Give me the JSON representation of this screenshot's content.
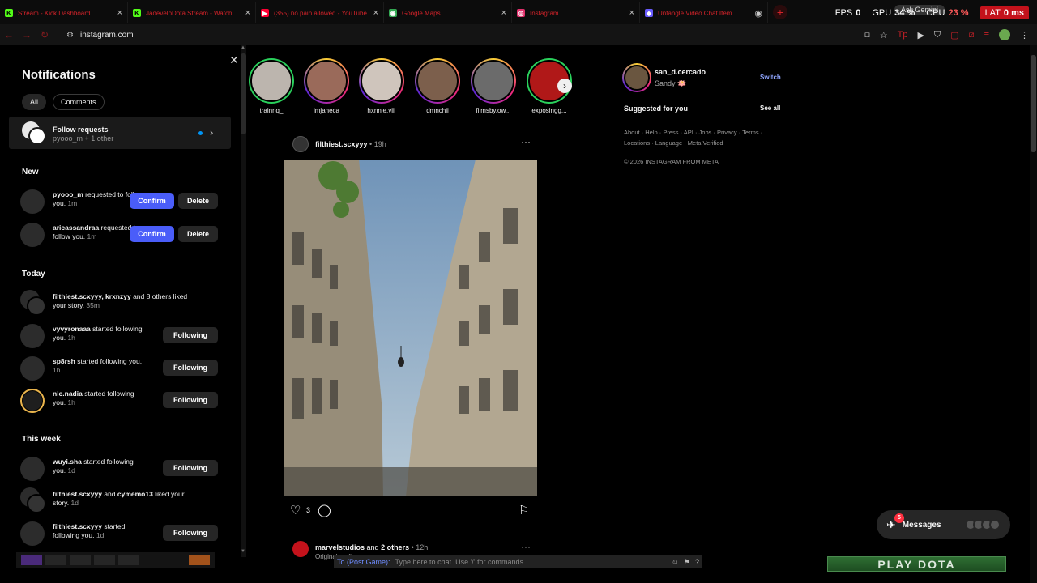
{
  "browser": {
    "tabs": [
      {
        "title": "Stream - Kick Dashboard",
        "favicon": "K",
        "color": "#53fc18"
      },
      {
        "title": "JadeveloDota Stream - Watch",
        "favicon": "K",
        "color": "#53fc18"
      },
      {
        "title": "(355) no pain allowed - YouTube",
        "favicon": "▶",
        "color": "#ff0033"
      },
      {
        "title": "Google Maps",
        "favicon": "◉",
        "color": "#34a853"
      },
      {
        "title": "Instagram",
        "favicon": "◎",
        "color": "#e1306c"
      },
      {
        "title": "Untangle Video Chat Item",
        "favicon": "◆",
        "color": "#6a5cff"
      }
    ],
    "url": "instagram.com",
    "ask_gemini": "Ask Gemini"
  },
  "overlay": {
    "fps_label": "FPS",
    "fps_value": "0",
    "gpu_label": "GPU",
    "gpu_value": "34 %",
    "cpu_label": "CPU",
    "cpu_value": "23 %",
    "lat_label": "LAT",
    "lat_value": "0 ms"
  },
  "notifications": {
    "title": "Notifications",
    "filters": [
      "All",
      "Comments"
    ],
    "follow_requests": {
      "title": "Follow requests",
      "subtitle": "pyooo_m + 1 other"
    },
    "sections": {
      "new": "New",
      "today": "Today",
      "this_week": "This week"
    },
    "new_items": [
      {
        "user": "pyooo_m",
        "text": " requested to follow you. ",
        "time": "1m",
        "primary": "Confirm",
        "secondary": "Delete"
      },
      {
        "user": "aricassandraa",
        "text": " requested to follow you. ",
        "time": "1m",
        "primary": "Confirm",
        "secondary": "Delete"
      }
    ],
    "today_items": [
      {
        "user": "filthiest.scxyyy, krxnzyy",
        "text": " and 8 others liked your story. ",
        "time": "35m",
        "button": ""
      },
      {
        "user": "vyvyronaaa",
        "text": " started following you. ",
        "time": "1h",
        "button": "Following"
      },
      {
        "user": "sp8rsh",
        "text": " started following you. ",
        "time": "1h",
        "button": "Following"
      },
      {
        "user": "nlc.nadia",
        "text": " started following you. ",
        "time": "1h",
        "button": "Following"
      }
    ],
    "week_items": [
      {
        "user": "wuyi.sha",
        "text": " started following you. ",
        "time": "1d",
        "button": "Following"
      },
      {
        "user": "filthiest.scxyyy",
        "text": " and ",
        "user2": "cymemo13",
        "text2": " liked your story. ",
        "time": "1d",
        "button": ""
      },
      {
        "user": "filthiest.scxyyy",
        "text": " started following you. ",
        "time": "1d",
        "button": "Following"
      }
    ]
  },
  "stories": [
    {
      "name": "trainnq_"
    },
    {
      "name": "imjaneca"
    },
    {
      "name": "hxnnie.viii"
    },
    {
      "name": "dmnchii"
    },
    {
      "name": "filmsby.ow..."
    },
    {
      "name": "exposingg..."
    }
  ],
  "post": {
    "user": "filthiest.scxyyy",
    "time": "19h",
    "likes": "3"
  },
  "post2": {
    "user": "marvelstudios",
    "and_others": " and ",
    "others": "2 others",
    "time": "12h",
    "sub": "Original audio"
  },
  "sidebar_right": {
    "username": "san_d.cercado",
    "display": "Sandy 🪷",
    "switch": "Switch",
    "suggested": "Suggested for you",
    "see_all": "See all",
    "links": "About · Help · Press · API · Jobs · Privacy · Terms · Locations · Language · Meta Verified",
    "copyright": "© 2026 INSTAGRAM FROM META"
  },
  "messages": {
    "label": "Messages",
    "badge": "5"
  },
  "game": {
    "chat_label": "To (Post Game):",
    "chat_placeholder": "Type here to chat. Use '/' for commands.",
    "play_button": "PLAY DOTA"
  }
}
